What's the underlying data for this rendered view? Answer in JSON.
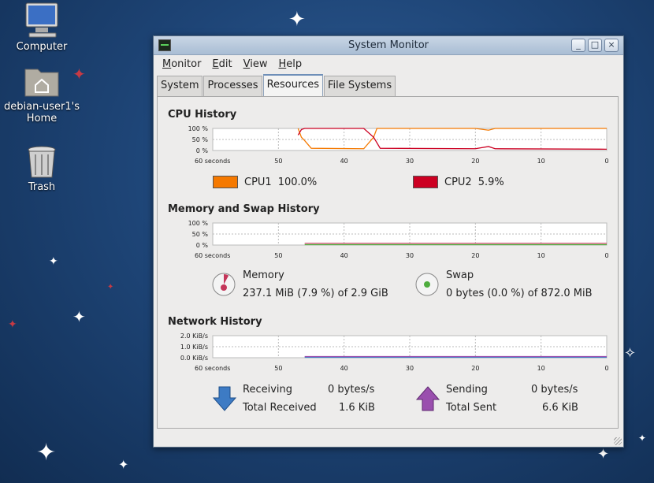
{
  "desktop": {
    "icons": [
      {
        "label": "Computer",
        "icon": "computer-icon"
      },
      {
        "label": "debian-user1's\nHome",
        "line1": "debian-user1's",
        "line2": "Home",
        "icon": "home-folder-icon"
      },
      {
        "label": "Trash",
        "icon": "trash-icon"
      }
    ]
  },
  "window": {
    "title": "System Monitor",
    "controls": {
      "minimize": "_",
      "maximize": "□",
      "close": "×"
    }
  },
  "menu": [
    "Monitor",
    "Edit",
    "View",
    "Help"
  ],
  "tabs": [
    {
      "label": "System",
      "active": false
    },
    {
      "label": "Processes",
      "active": false
    },
    {
      "label": "Resources",
      "active": true
    },
    {
      "label": "File Systems",
      "active": false
    }
  ],
  "cpu": {
    "title": "CPU History",
    "y_ticks": [
      "100 %",
      "50 %",
      "0 %"
    ],
    "x_ticks": [
      "60 seconds",
      "50",
      "40",
      "30",
      "20",
      "10",
      "0"
    ],
    "series": [
      {
        "name": "CPU1",
        "value": "100.0%",
        "color": "#f57900"
      },
      {
        "name": "CPU2",
        "value": "5.9%",
        "color": "#cc0022"
      }
    ]
  },
  "memory": {
    "title": "Memory and Swap History",
    "y_ticks": [
      "100 %",
      "50 %",
      "0 %"
    ],
    "x_ticks": [
      "60 seconds",
      "50",
      "40",
      "30",
      "20",
      "10",
      "0"
    ],
    "memory_label": "Memory",
    "memory_value": "237.1 MiB (7.9 %) of 2.9 GiB",
    "memory_fraction": 0.079,
    "memory_color": "#c4365a",
    "swap_label": "Swap",
    "swap_value": "0 bytes (0.0 %) of 872.0 MiB",
    "swap_fraction": 0.0,
    "swap_color": "#4fad3e"
  },
  "network": {
    "title": "Network History",
    "y_ticks": [
      "2.0 KiB/s",
      "1.0 KiB/s",
      "0.0 KiB/s"
    ],
    "x_ticks": [
      "60 seconds",
      "50",
      "40",
      "30",
      "20",
      "10",
      "0"
    ],
    "receiving_label": "Receiving",
    "receiving_value": "0 bytes/s",
    "total_received_label": "Total Received",
    "total_received_value": "1.6 KiB",
    "sending_label": "Sending",
    "sending_value": "0 bytes/s",
    "total_sent_label": "Total Sent",
    "total_sent_value": "6.6 KiB",
    "receiving_color": "#3d7bc4",
    "sending_color": "#9a4fae"
  }
}
